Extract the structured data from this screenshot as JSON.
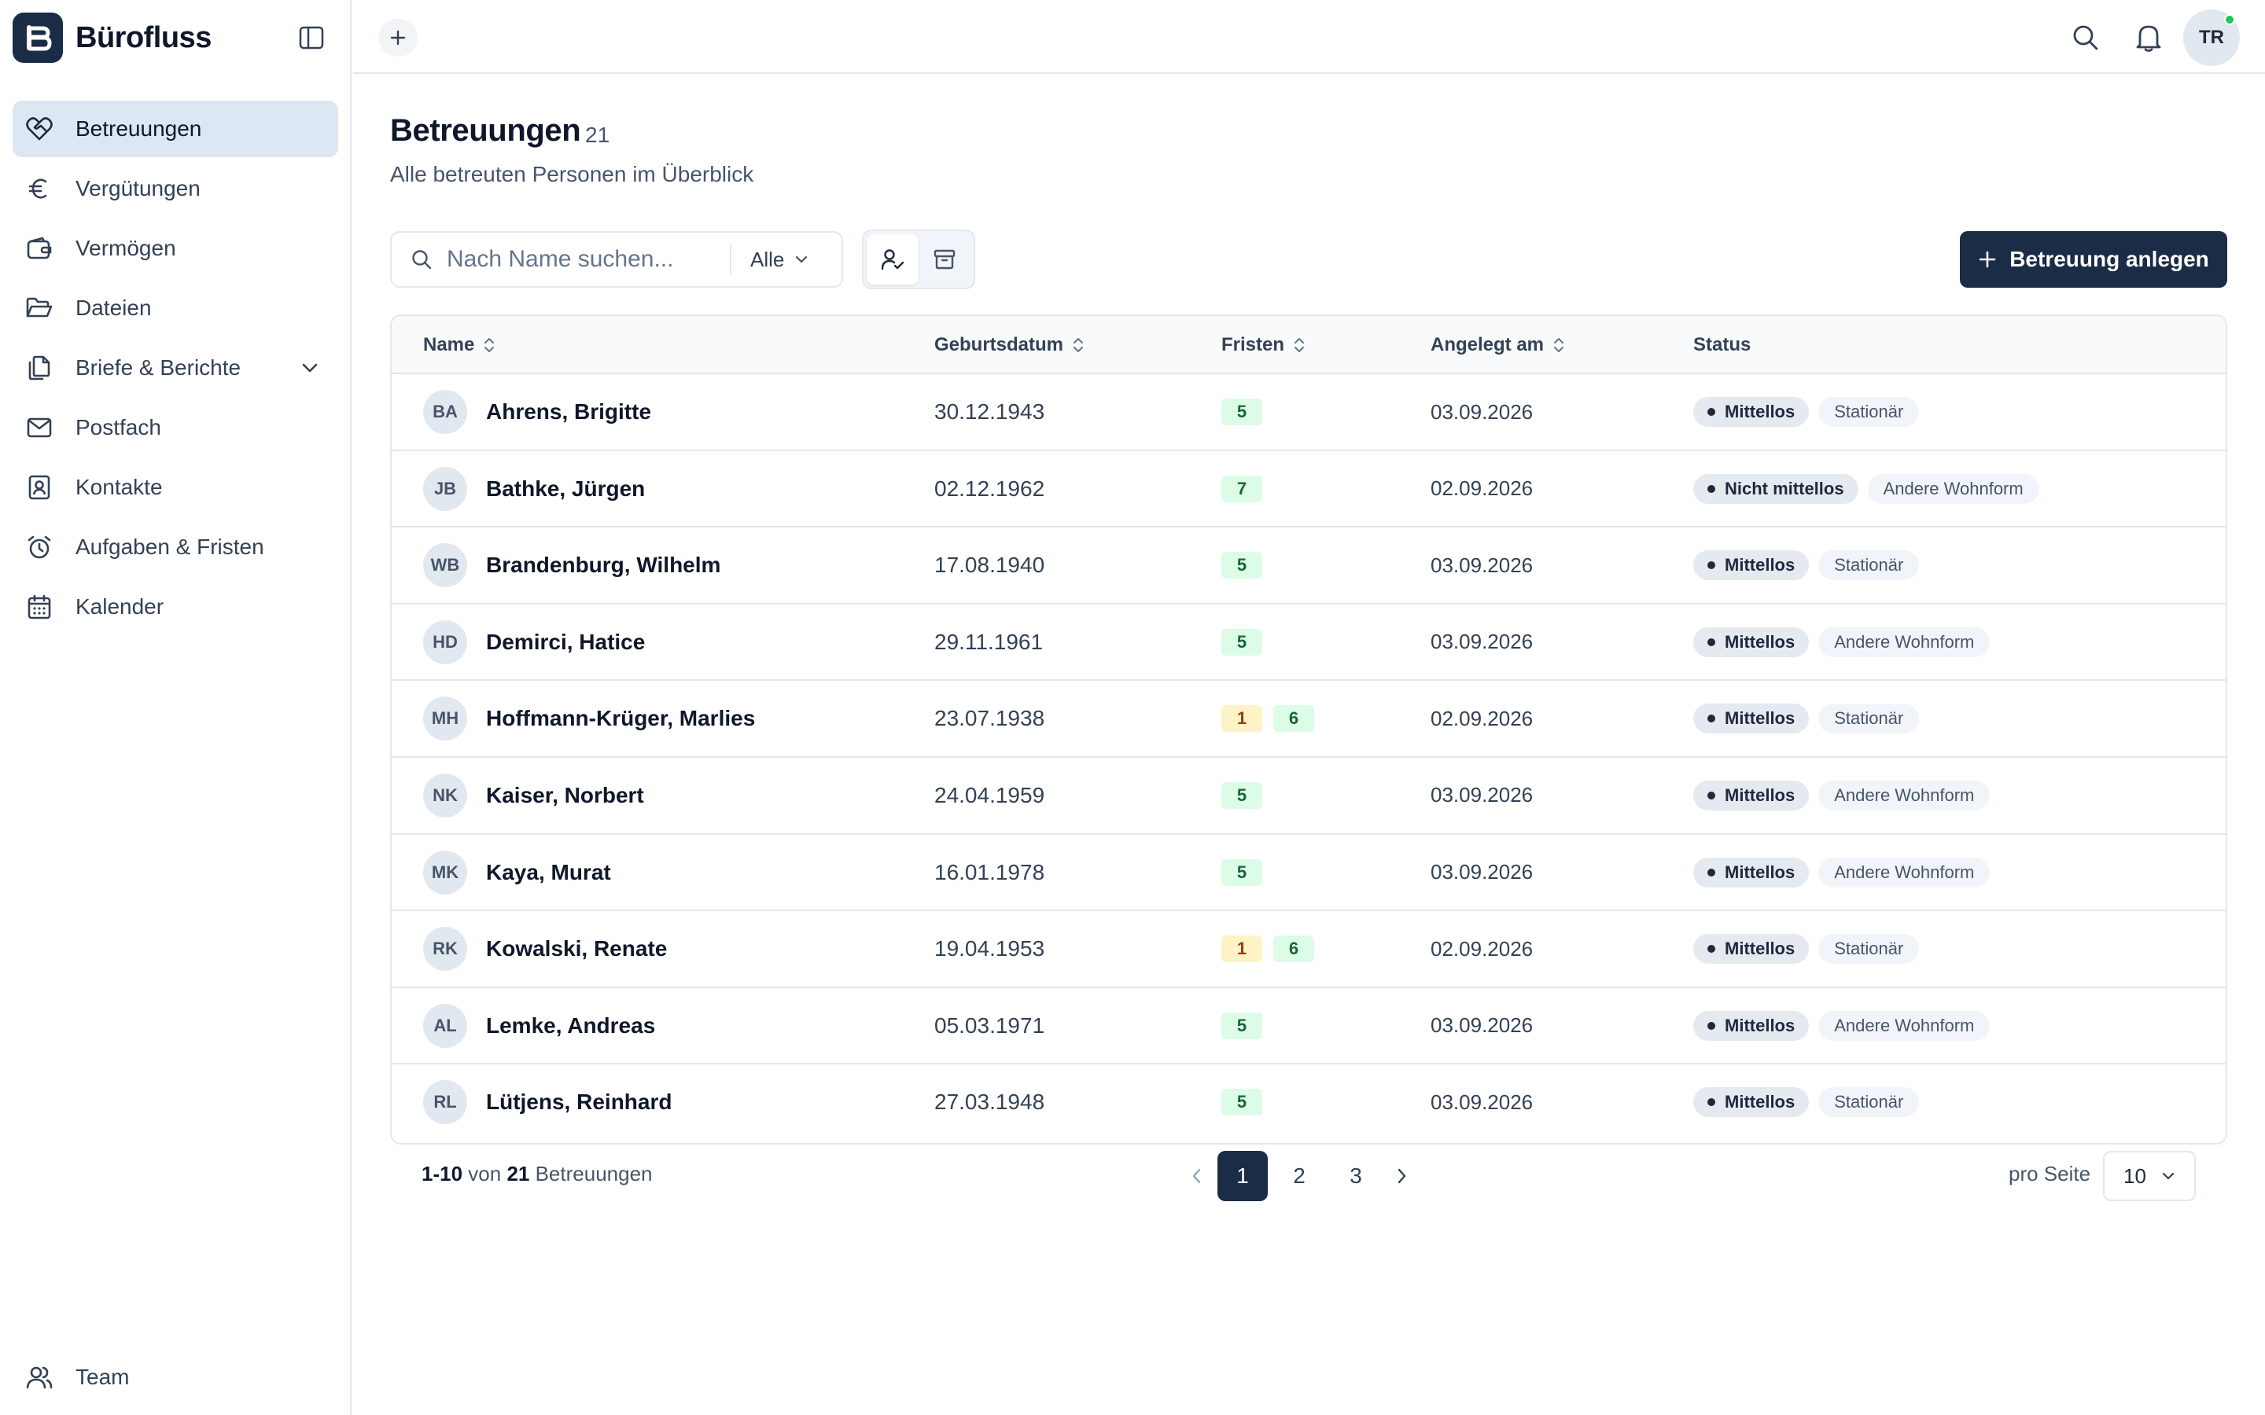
{
  "app": {
    "name": "Bürofluss",
    "user_initials": "TR"
  },
  "sidebar": {
    "items": [
      {
        "label": "Betreuungen",
        "icon": "heart-handshake-icon",
        "active": true
      },
      {
        "label": "Vergütungen",
        "icon": "euro-icon"
      },
      {
        "label": "Vermögen",
        "icon": "wallet-icon"
      },
      {
        "label": "Dateien",
        "icon": "folder-open-icon"
      },
      {
        "label": "Briefe & Berichte",
        "icon": "files-icon",
        "expandable": true
      },
      {
        "label": "Postfach",
        "icon": "mail-icon"
      },
      {
        "label": "Kontakte",
        "icon": "contact-icon"
      },
      {
        "label": "Aufgaben & Fristen",
        "icon": "alarm-clock-icon"
      },
      {
        "label": "Kalender",
        "icon": "calendar-icon"
      }
    ],
    "bottom": {
      "label": "Team",
      "icon": "users-icon"
    }
  },
  "page": {
    "title": "Betreuungen",
    "count": "21",
    "subtitle": "Alle betreuten Personen im Überblick"
  },
  "toolbar": {
    "search_placeholder": "Nach Name suchen...",
    "filter_value": "Alle",
    "create_label": "Betreuung anlegen"
  },
  "table": {
    "columns": {
      "name": "Name",
      "birth": "Geburtsdatum",
      "deadlines": "Fristen",
      "created": "Angelegt am",
      "status": "Status"
    },
    "rows": [
      {
        "initials": "BA",
        "name": "Ahrens, Brigitte",
        "birth": "30.12.1943",
        "deadlines_amber": "",
        "deadlines_green": "5",
        "created": "03.09.2026",
        "status": "Mittellos",
        "living": "Stationär"
      },
      {
        "initials": "JB",
        "name": "Bathke, Jürgen",
        "birth": "02.12.1962",
        "deadlines_amber": "",
        "deadlines_green": "7",
        "created": "02.09.2026",
        "status": "Nicht mittellos",
        "living": "Andere Wohnform"
      },
      {
        "initials": "WB",
        "name": "Brandenburg, Wilhelm",
        "birth": "17.08.1940",
        "deadlines_amber": "",
        "deadlines_green": "5",
        "created": "03.09.2026",
        "status": "Mittellos",
        "living": "Stationär"
      },
      {
        "initials": "HD",
        "name": "Demirci, Hatice",
        "birth": "29.11.1961",
        "deadlines_amber": "",
        "deadlines_green": "5",
        "created": "03.09.2026",
        "status": "Mittellos",
        "living": "Andere Wohnform"
      },
      {
        "initials": "MH",
        "name": "Hoffmann-Krüger, Marlies",
        "birth": "23.07.1938",
        "deadlines_amber": "1",
        "deadlines_green": "6",
        "created": "02.09.2026",
        "status": "Mittellos",
        "living": "Stationär"
      },
      {
        "initials": "NK",
        "name": "Kaiser, Norbert",
        "birth": "24.04.1959",
        "deadlines_amber": "",
        "deadlines_green": "5",
        "created": "03.09.2026",
        "status": "Mittellos",
        "living": "Andere Wohnform"
      },
      {
        "initials": "MK",
        "name": "Kaya, Murat",
        "birth": "16.01.1978",
        "deadlines_amber": "",
        "deadlines_green": "5",
        "created": "03.09.2026",
        "status": "Mittellos",
        "living": "Andere Wohnform"
      },
      {
        "initials": "RK",
        "name": "Kowalski, Renate",
        "birth": "19.04.1953",
        "deadlines_amber": "1",
        "deadlines_green": "6",
        "created": "02.09.2026",
        "status": "Mittellos",
        "living": "Stationär"
      },
      {
        "initials": "AL",
        "name": "Lemke, Andreas",
        "birth": "05.03.1971",
        "deadlines_amber": "",
        "deadlines_green": "5",
        "created": "03.09.2026",
        "status": "Mittellos",
        "living": "Andere Wohnform"
      },
      {
        "initials": "RL",
        "name": "Lütjens, Reinhard",
        "birth": "27.03.1948",
        "deadlines_amber": "",
        "deadlines_green": "5",
        "created": "03.09.2026",
        "status": "Mittellos",
        "living": "Stationär"
      }
    ]
  },
  "pagination": {
    "range": "1-10",
    "of_label": "von",
    "total": "21",
    "unit": "Betreuungen",
    "pages": [
      "1",
      "2",
      "3"
    ],
    "current": "1",
    "per_page_label": "pro Seite",
    "per_page_value": "10"
  },
  "colors": {
    "primary": "#1b2c47",
    "active_nav": "#dde7f3",
    "badge_green_bg": "#dcfce7",
    "badge_amber_bg": "#fef3c7",
    "online": "#22c55e"
  }
}
